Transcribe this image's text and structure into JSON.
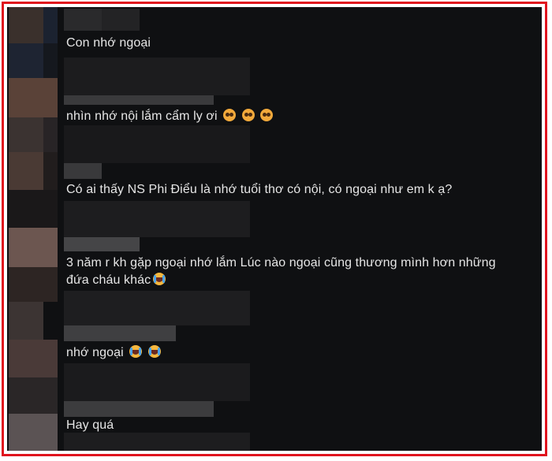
{
  "comments": [
    {
      "text": "Con nhớ ngoại"
    },
    {
      "text": "nhìn nhớ nội lắm cẩm ly ơi",
      "emojis": [
        "pleading-face",
        "pleading-face",
        "pleading-face"
      ]
    },
    {
      "text": "Có ai thấy NS Phi Điểu là nhớ tuổi thơ có nội, có ngoại như em k ạ?"
    },
    {
      "text_line1": "3 năm r kh gặp ngoại nhớ lắm Lúc nào ngoại cũng thương mình hơn những",
      "text_line2": "đứa cháu khác",
      "emojis": [
        "loudly-crying-face"
      ]
    },
    {
      "text": "nhớ ngoại",
      "emojis": [
        "loudly-crying-face",
        "loudly-crying-face"
      ]
    },
    {
      "text": "Hay quá"
    }
  ],
  "colors": {
    "frame_border": "#e0141e",
    "background": "#0f1012",
    "comment_text": "#e6e6e6"
  }
}
